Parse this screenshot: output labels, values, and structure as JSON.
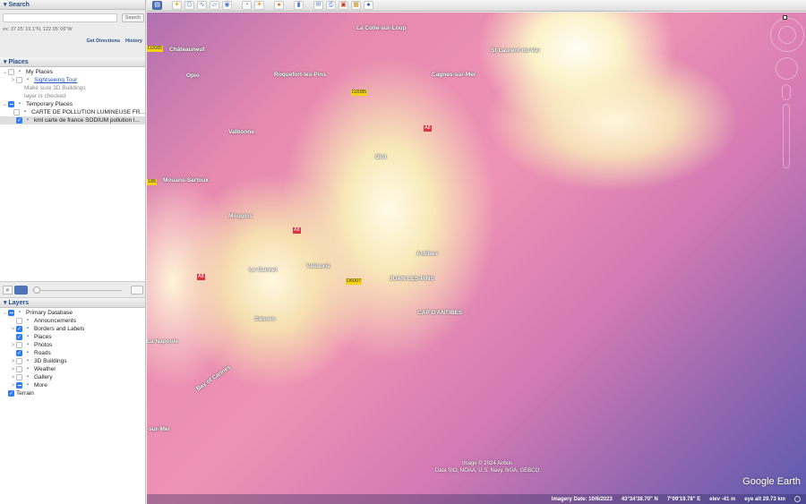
{
  "search": {
    "title": "Search",
    "button": "Search",
    "placeholder": "",
    "hint": "ex: 37 25' 19.1\"N, 122 05' 06\"W",
    "get_directions": "Get Directions",
    "history": "History"
  },
  "places": {
    "title": "Places",
    "items": [
      {
        "label": "My Places",
        "level": 0,
        "arrow": "v",
        "check": "off",
        "icon": "globe-folder-icon"
      },
      {
        "label": "Sightseeing Tour",
        "level": 1,
        "arrow": ">",
        "check": "off",
        "icon": "tour-icon",
        "link": true
      },
      {
        "label": "Make sure 3D Buildings",
        "level": 2,
        "arrow": "",
        "check": "none",
        "gray": true
      },
      {
        "label": "layer is checked",
        "level": 2,
        "arrow": "",
        "check": "none",
        "gray": true
      },
      {
        "label": "Temporary Places",
        "level": 0,
        "arrow": "v",
        "check": "mix",
        "icon": "folder-icon"
      },
      {
        "label": "CARTE DE POLLUTION LUMINEUSE FR...",
        "level": 1,
        "arrow": "",
        "check": "off",
        "icon": "kml-icon"
      },
      {
        "label": "kml carte de france SODIUM pollution l...",
        "level": 1,
        "arrow": "",
        "check": "on",
        "icon": "kml-icon",
        "selected": true
      }
    ]
  },
  "layers": {
    "title": "Layers",
    "items": [
      {
        "label": "Primary Database",
        "level": 0,
        "arrow": "v",
        "check": "mix",
        "icon": "database-icon"
      },
      {
        "label": "Announcements",
        "level": 1,
        "arrow": "",
        "check": "off",
        "icon": "envelope-icon"
      },
      {
        "label": "Borders and Labels",
        "level": 1,
        "arrow": ">",
        "check": "on",
        "icon": "flag-icon"
      },
      {
        "label": "Places",
        "level": 1,
        "arrow": "",
        "check": "on",
        "icon": "place-icon"
      },
      {
        "label": "Photos",
        "level": 1,
        "arrow": ">",
        "check": "off",
        "icon": "photo-icon"
      },
      {
        "label": "Roads",
        "level": 1,
        "arrow": "",
        "check": "on",
        "icon": "road-icon"
      },
      {
        "label": "3D Buildings",
        "level": 1,
        "arrow": ">",
        "check": "off",
        "icon": "building-icon"
      },
      {
        "label": "Weather",
        "level": 1,
        "arrow": ">",
        "check": "off",
        "icon": "weather-icon"
      },
      {
        "label": "Gallery",
        "level": 1,
        "arrow": ">",
        "check": "off",
        "icon": "star-icon"
      },
      {
        "label": "More",
        "level": 1,
        "arrow": ">",
        "check": "mix",
        "icon": "more-icon"
      },
      {
        "label": "Terrain",
        "level": 0,
        "arrow": "",
        "check": "on",
        "icon": ""
      }
    ]
  },
  "map": {
    "places": [
      "La Colle-sur-Loup",
      "St-Laurent-du-Var",
      "Châteauneuf",
      "Opio",
      "Roquefort-les-Pins",
      "Cagnes-sur-Mer",
      "Valbonne",
      "Biot",
      "Mouans-Sartoux",
      "Mougins",
      "Antibes",
      "Le Cannet",
      "Vallauris",
      "JUAN-LES-PINS",
      "CAP D'ANTIBES",
      "Cannes",
      "La Napoule",
      "Bay of Cannes",
      "-sur-Mer"
    ],
    "roads": [
      "D2085",
      "D2085",
      "A8",
      "185",
      "A8",
      "A8",
      "D6007"
    ],
    "attribution": [
      "Image © 2024 Airbus",
      "Data SIO, NOAA, U.S. Navy, NGA, GEBCO"
    ],
    "logo": "Google Earth"
  },
  "status": {
    "imagery_date": "Imagery Date: 10/6/2023",
    "lat": "43°34'38.70\" N",
    "lon": "7°09'19.78\" E",
    "elev": "elev   -41 m",
    "eye_alt": "eye alt  29.73 km"
  }
}
